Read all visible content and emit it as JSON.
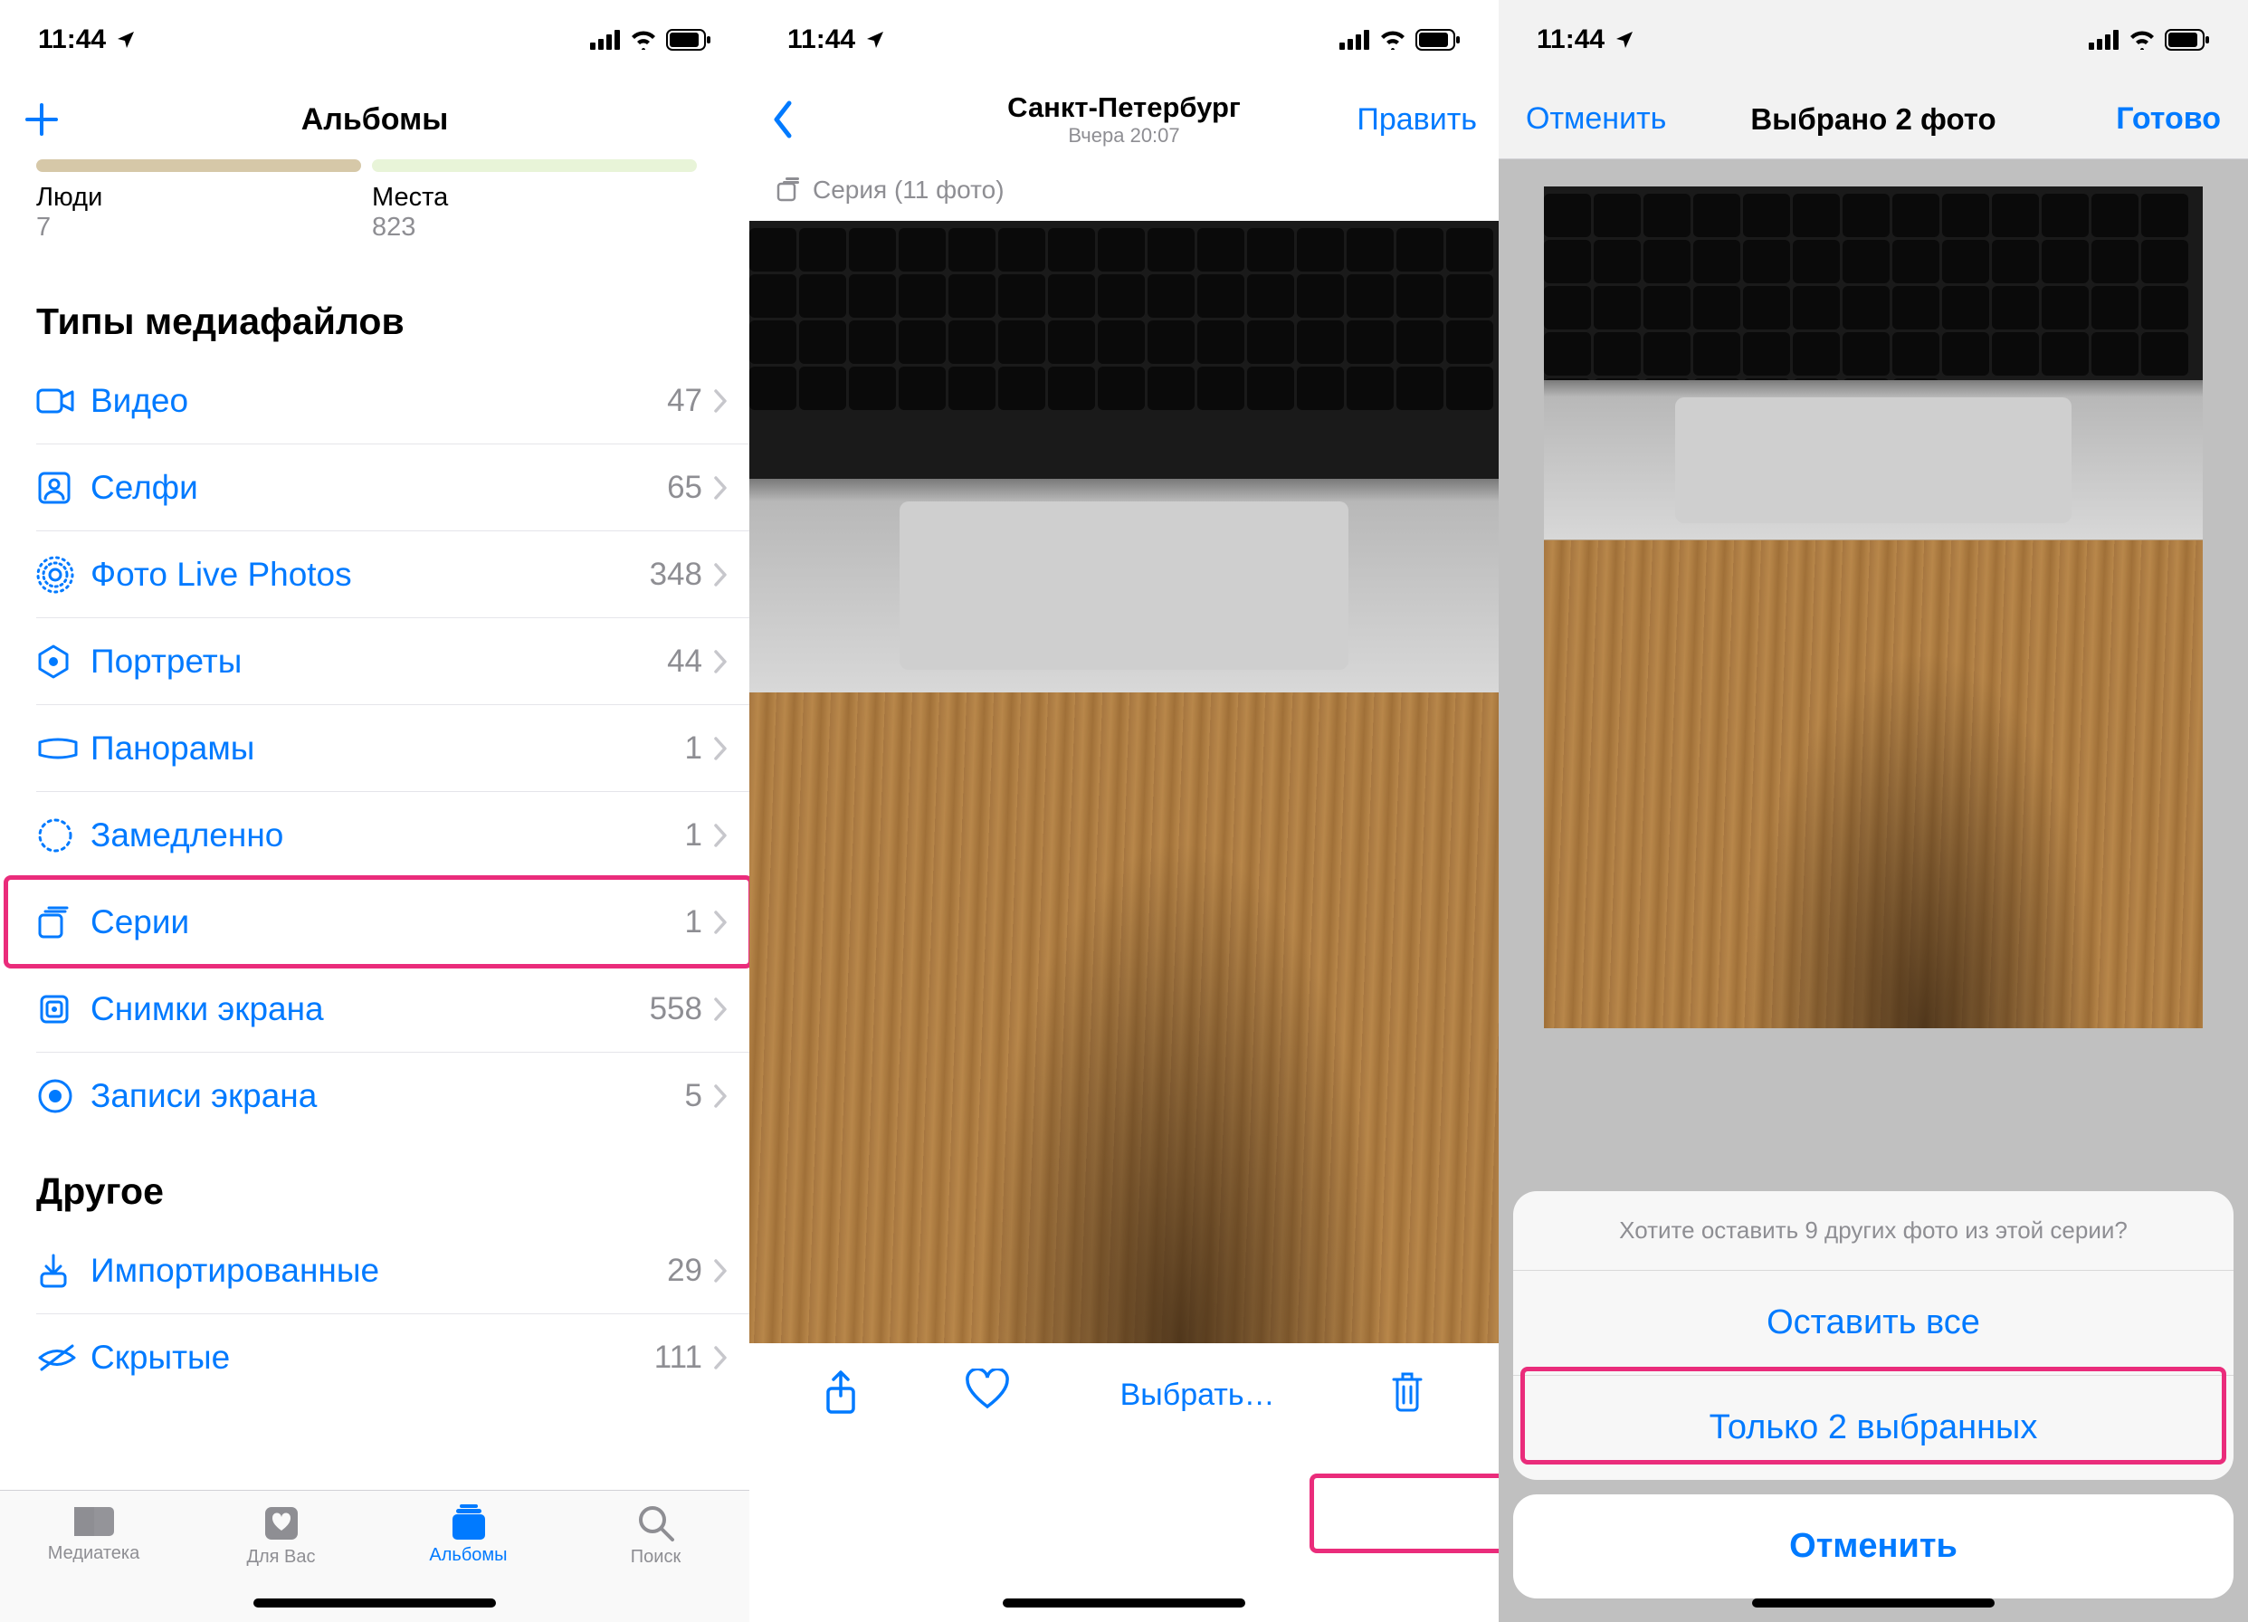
{
  "status": {
    "time": "11:44"
  },
  "accent": "#007aff",
  "highlight": "#ea2c7b",
  "screen1": {
    "nav_title": "Альбомы",
    "albums": [
      {
        "label": "Люди",
        "count": "7"
      },
      {
        "label": "Места",
        "count": "823"
      }
    ],
    "sections": [
      {
        "header": "Типы медиафайлов",
        "items": [
          {
            "icon": "video",
            "label": "Видео",
            "count": "47"
          },
          {
            "icon": "selfie",
            "label": "Селфи",
            "count": "65"
          },
          {
            "icon": "live",
            "label": "Фото Live Photos",
            "count": "348"
          },
          {
            "icon": "portrait",
            "label": "Портреты",
            "count": "44"
          },
          {
            "icon": "panorama",
            "label": "Панорамы",
            "count": "1"
          },
          {
            "icon": "slomo",
            "label": "Замедленно",
            "count": "1"
          },
          {
            "icon": "burst",
            "label": "Серии",
            "count": "1",
            "highlight": true
          },
          {
            "icon": "screenshot",
            "label": "Снимки экрана",
            "count": "558"
          },
          {
            "icon": "screenrec",
            "label": "Записи экрана",
            "count": "5"
          }
        ]
      },
      {
        "header": "Другое",
        "items": [
          {
            "icon": "import",
            "label": "Импортированные",
            "count": "29"
          },
          {
            "icon": "hidden",
            "label": "Скрытые",
            "count": "111"
          }
        ]
      }
    ],
    "tabs": [
      {
        "icon": "library",
        "label": "Медиатека"
      },
      {
        "icon": "foryou",
        "label": "Для Вас"
      },
      {
        "icon": "albums",
        "label": "Альбомы",
        "active": true
      },
      {
        "icon": "search",
        "label": "Поиск"
      }
    ]
  },
  "screen2": {
    "nav_title": "Санкт-Петербург",
    "nav_subtitle": "Вчера  20:07",
    "edit": "Править",
    "burst_label": "Серия (11 фото)",
    "select_label": "Выбрать…"
  },
  "screen3": {
    "cancel": "Отменить",
    "nav_title": "Выбрано 2 фото",
    "done": "Готово",
    "sheet_title": "Хотите оставить 9 других фото из этой серии?",
    "keep_all": "Оставить все",
    "keep_selected": "Только 2 выбранных",
    "sheet_cancel": "Отменить"
  }
}
